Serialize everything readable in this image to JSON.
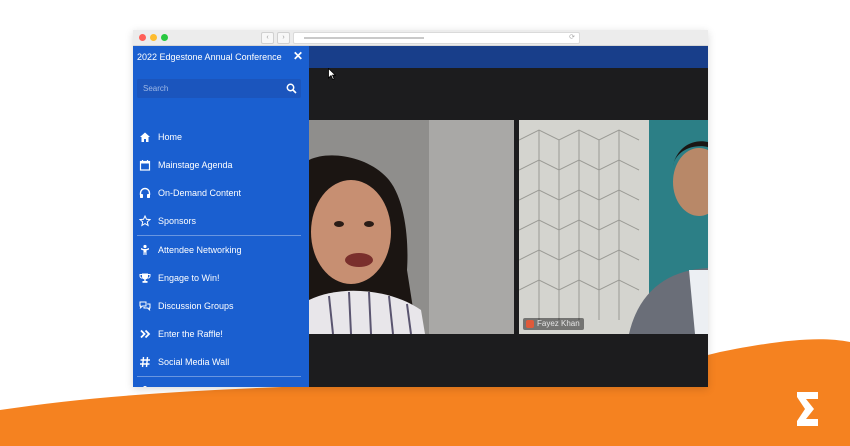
{
  "sidebar": {
    "title": "2022 Edgestone Annual Conference",
    "search_placeholder": "Search",
    "groups": [
      [
        {
          "label": "Home",
          "icon": "home-icon"
        },
        {
          "label": "Mainstage Agenda",
          "icon": "calendar-icon"
        },
        {
          "label": "On-Demand Content",
          "icon": "headphones-icon"
        },
        {
          "label": "Sponsors",
          "icon": "star-icon"
        }
      ],
      [
        {
          "label": "Attendee Networking",
          "icon": "person-icon"
        },
        {
          "label": "Engage to Win!",
          "icon": "trophy-icon"
        },
        {
          "label": "Discussion Groups",
          "icon": "chat-icon"
        },
        {
          "label": "Enter the Raffle!",
          "icon": "double-chevron-icon"
        },
        {
          "label": "Social Media Wall",
          "icon": "hashtag-icon"
        }
      ]
    ]
  },
  "video": {
    "participant_2_name": "Fayez Khan"
  },
  "colors": {
    "sidebar": "#1a5fd0",
    "appbar": "#183e8a",
    "brand_orange": "#f58220"
  }
}
